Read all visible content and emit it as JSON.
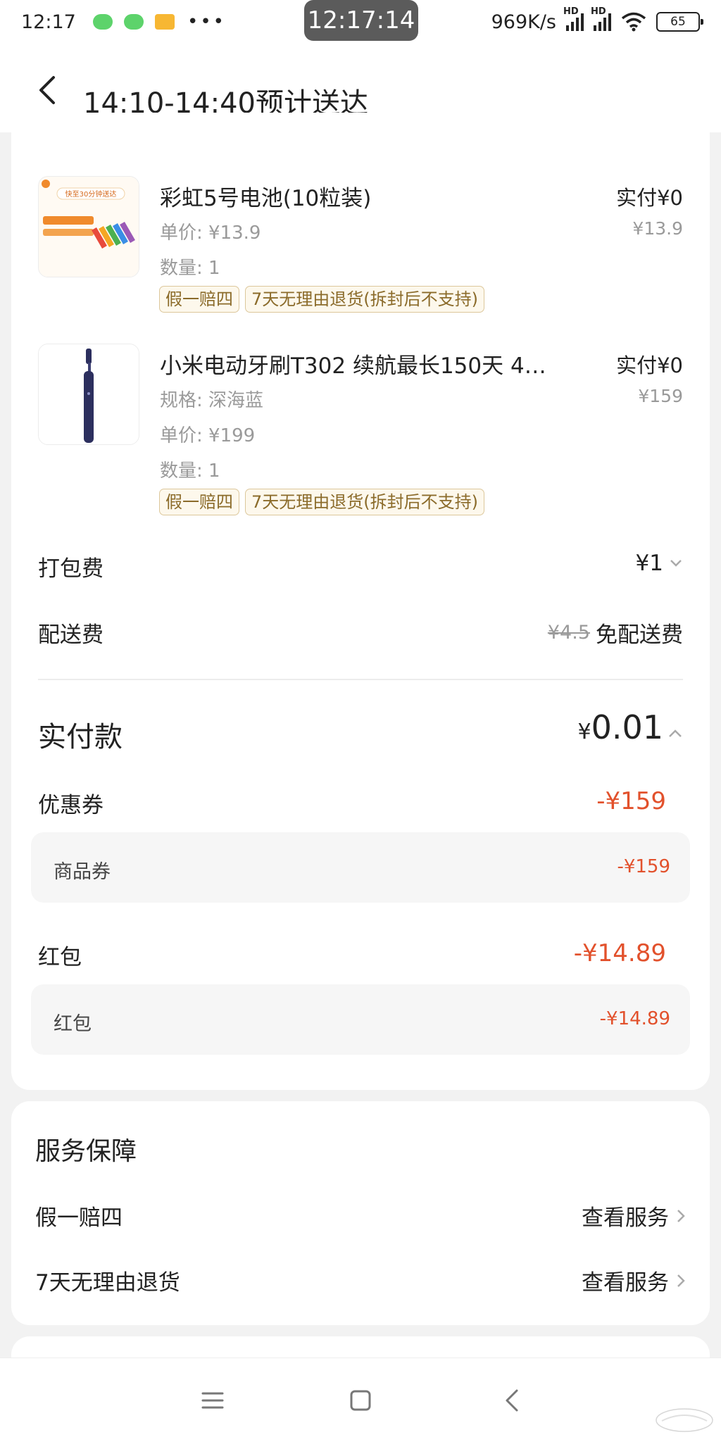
{
  "status_bar": {
    "time": "12:17",
    "clock_overlay": "12:17:14",
    "network_speed": "969K/s",
    "signal_label": "HD",
    "battery": "65",
    "notification_colors": [
      "#5dd36b",
      "#5dd36b",
      "#f7b733"
    ]
  },
  "header": {
    "title": "14:10-14:40预计送达"
  },
  "items": [
    {
      "title": "彩虹5号电池(10粒装)",
      "unit_price": "单价: ¥13.9",
      "quantity": "数量: 1",
      "paid": "实付¥0",
      "original_price": "¥13.9",
      "tags": [
        "假一赔四",
        "7天无理由退货(拆封后不支持)"
      ],
      "thumb_text": "快至30分钟送达"
    },
    {
      "title": "小米电动牙刷T302 续航最长150天 4…",
      "spec": "规格: 深海蓝",
      "unit_price": "单价: ¥199",
      "quantity": "数量: 1",
      "paid": "实付¥0",
      "original_price": "¥159",
      "tags": [
        "假一赔四",
        "7天无理由退货(拆封后不支持)"
      ]
    }
  ],
  "fees": {
    "packing_label": "打包费",
    "packing_value": "¥1",
    "delivery_label": "配送费",
    "delivery_original": "¥4.5",
    "delivery_value": "免配送费"
  },
  "total": {
    "label": "实付款",
    "currency": "¥",
    "amount": "0.01"
  },
  "discounts": {
    "coupon_label": "优惠券",
    "coupon_amount": "-¥159",
    "coupon_sub_label": "商品券",
    "coupon_sub_amount": "-¥159",
    "redpacket_label": "红包",
    "redpacket_amount": "-¥14.89",
    "redpacket_sub_label": "红包",
    "redpacket_sub_amount": "-¥14.89"
  },
  "service": {
    "title": "服务保障",
    "rows": [
      {
        "name": "假一赔四",
        "link": "查看服务"
      },
      {
        "name": "7天无理由退货",
        "link": "查看服务"
      }
    ]
  },
  "colors": {
    "accent_red": "#e2512c",
    "tag_gold": "#8b6b2a",
    "toothbrush": "#2c2f5e",
    "battery_orange": "#f08a2c"
  }
}
